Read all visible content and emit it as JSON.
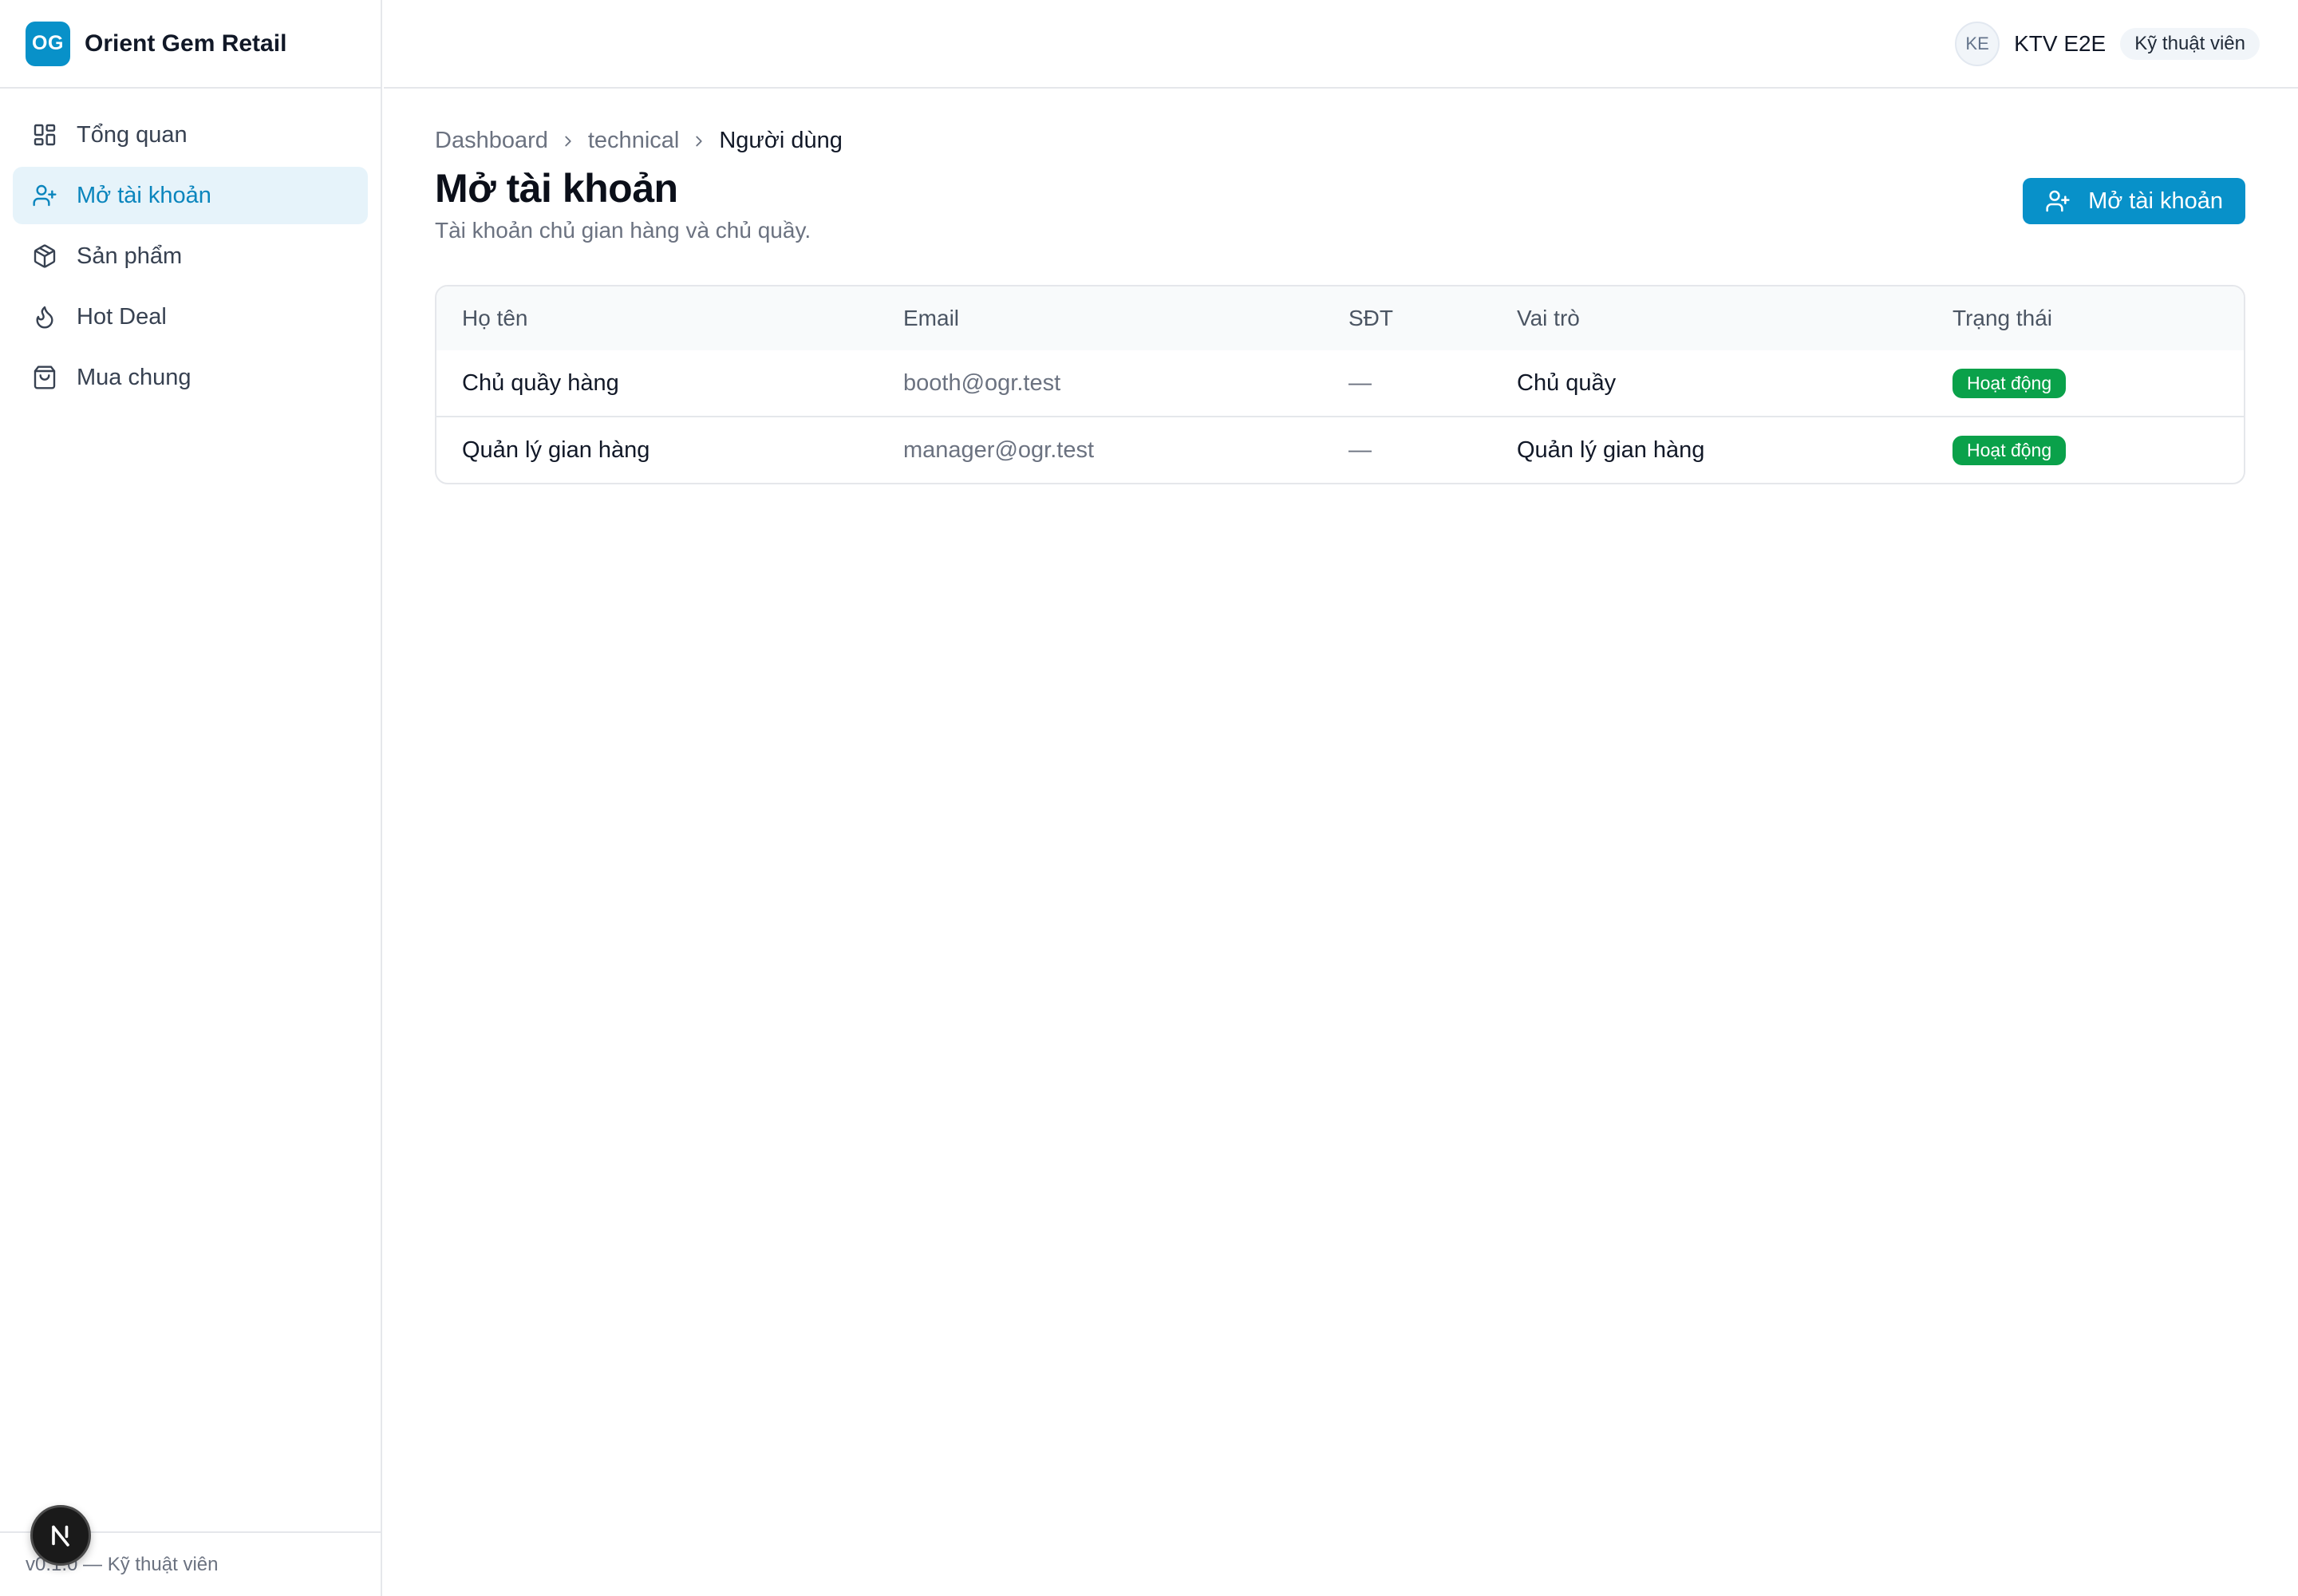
{
  "brand": {
    "logo_text": "OG",
    "name": "Orient Gem Retail",
    "color": "#0891c9"
  },
  "sidebar": {
    "items": [
      {
        "label": "Tổng quan",
        "icon": "dashboard-grid-icon",
        "active": false
      },
      {
        "label": "Mở tài khoản",
        "icon": "user-plus-icon",
        "active": true
      },
      {
        "label": "Sản phẩm",
        "icon": "package-icon",
        "active": false
      },
      {
        "label": "Hot Deal",
        "icon": "flame-icon",
        "active": false
      },
      {
        "label": "Mua chung",
        "icon": "shopping-bag-icon",
        "active": false
      }
    ],
    "footer": "v0.1.0 — Kỹ thuật viên"
  },
  "header": {
    "avatar_initials": "KE",
    "user_name": "KTV E2E",
    "role": "Kỹ thuật viên"
  },
  "breadcrumb": [
    "Dashboard",
    "technical",
    "Người dùng"
  ],
  "page": {
    "title": "Mở tài khoản",
    "subtitle": "Tài khoản chủ gian hàng và chủ quầy.",
    "primary_button": "Mở tài khoản"
  },
  "table": {
    "columns": [
      "Họ tên",
      "Email",
      "SĐT",
      "Vai trò",
      "Trạng thái"
    ],
    "rows": [
      {
        "name": "Chủ quầy hàng",
        "email": "booth@ogr.test",
        "phone": "—",
        "role": "Chủ quầy",
        "status": "Hoạt động"
      },
      {
        "name": "Quản lý gian hàng",
        "email": "manager@ogr.test",
        "phone": "—",
        "role": "Quản lý gian hàng",
        "status": "Hoạt động"
      }
    ]
  },
  "colors": {
    "accent": "#0891c9",
    "active_bg": "#e6f3fa",
    "status_active": "#0aa14a"
  },
  "dev_badge": {
    "letter": "N",
    "icon": "nextjs-icon"
  }
}
